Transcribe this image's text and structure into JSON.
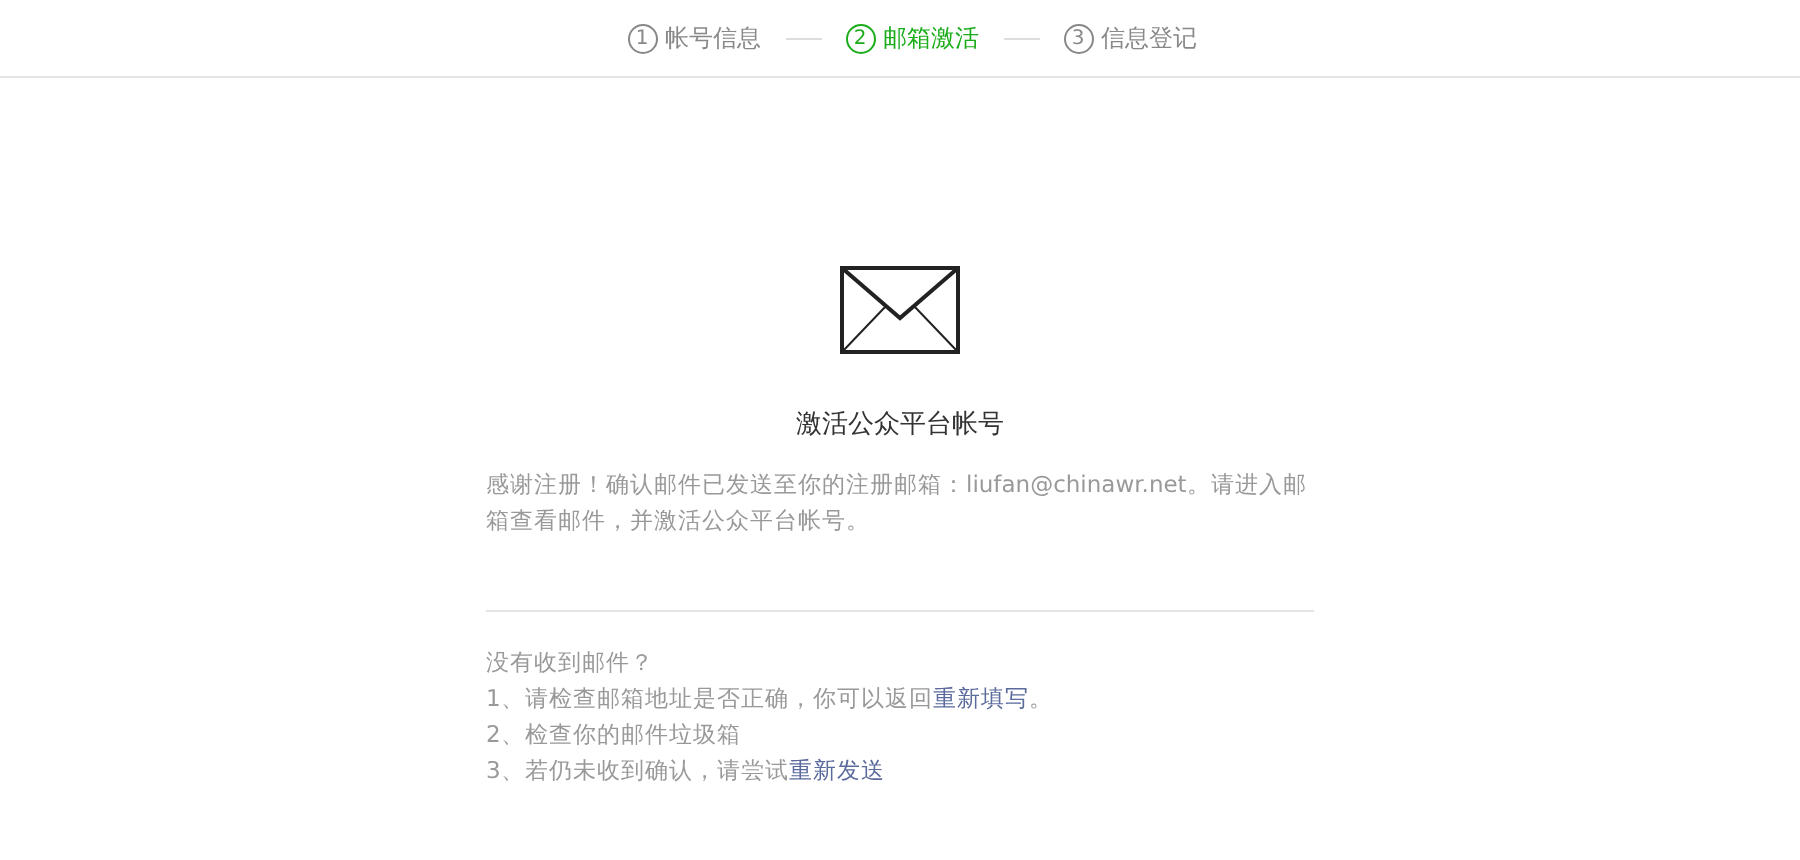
{
  "steps": [
    {
      "number": "1",
      "label": "帐号信息",
      "selected": false
    },
    {
      "number": "2",
      "label": "邮箱激活",
      "selected": true
    },
    {
      "number": "3",
      "label": "信息登记",
      "selected": false
    }
  ],
  "title": "激活公众平台帐号",
  "message": "感谢注册！确认邮件已发送至你的注册邮箱：liufan@chinawr.net。请进入邮箱查看邮件，并激活公众平台帐号。",
  "help": {
    "heading": "没有收到邮件？",
    "lines": [
      {
        "text": "1、请检查邮箱地址是否正确，你可以返回",
        "link": "重新填写",
        "after": "。"
      },
      {
        "text": "2、检查你的邮件垃圾箱"
      },
      {
        "text": "3、若仍未收到确认，请尝试",
        "link": "重新发送"
      }
    ]
  }
}
